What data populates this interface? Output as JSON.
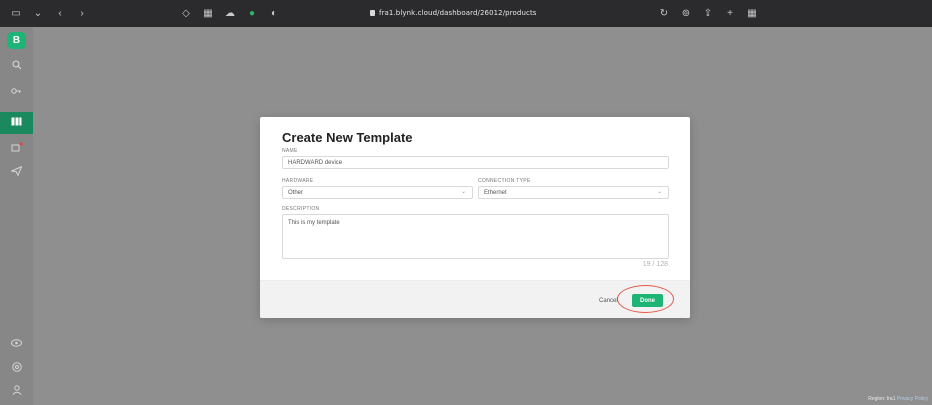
{
  "browser": {
    "address": "fra1.blynk.cloud/dashboard/26012/products",
    "left_icons": [
      "sidebar-toggle-icon",
      "chevron-down-icon",
      "back-icon",
      "forward-icon"
    ],
    "mid_icons": [
      "shield-icon",
      "grid-icon",
      "cloud-icon",
      "extension-icon",
      "toggle-icon"
    ],
    "right_icons": [
      "refresh-icon",
      "share-icon",
      "upload-icon",
      "new-tab-icon",
      "tabs-grid-icon"
    ]
  },
  "sidebar": {
    "logo_letter": "B",
    "items": [
      {
        "icon": "search-icon"
      },
      {
        "icon": "key-icon"
      },
      {
        "icon": "templates-icon",
        "active": true
      },
      {
        "icon": "devices-icon",
        "badge": true
      },
      {
        "icon": "send-icon"
      }
    ],
    "bottom_items": [
      {
        "icon": "eye-icon"
      },
      {
        "icon": "help-icon"
      },
      {
        "icon": "user-icon"
      }
    ]
  },
  "modal": {
    "title": "Create New Template",
    "name_label": "NAME",
    "name_value": "HARDWARD device",
    "hardware_label": "HARDWARE",
    "hardware_value": "Other",
    "connection_label": "CONNECTION TYPE",
    "connection_value": "Ethernet",
    "description_label": "DESCRIPTION",
    "description_value": "This is my template",
    "counter": "19 / 128",
    "cancel_label": "Cancel",
    "done_label": "Done"
  },
  "footer": {
    "region": "Region: fra1",
    "privacy": "Privacy Policy"
  },
  "colors": {
    "accent": "#1db475",
    "highlight": "#e4584a",
    "overlay": "#8f8f8f"
  }
}
